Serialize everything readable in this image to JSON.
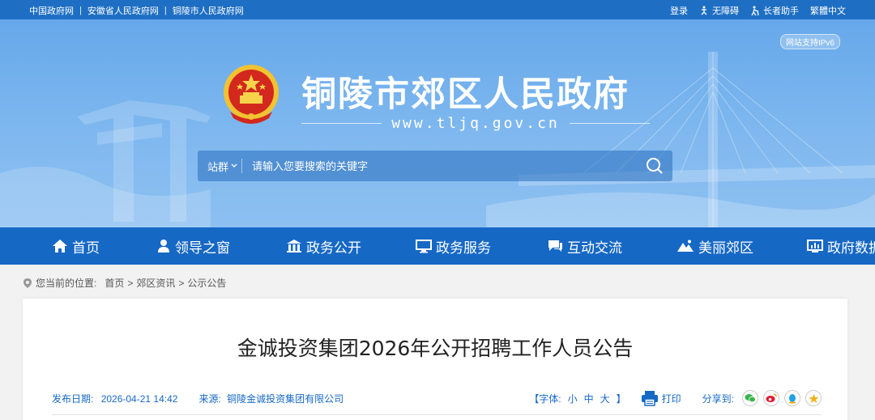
{
  "topbar": {
    "links": [
      "中国政府网",
      "安徽省人民政府网",
      "铜陵市人民政府网"
    ],
    "separator": "|",
    "login": "登录",
    "accessibility": "无障碍",
    "elder": "长者助手",
    "traditional": "繁體中文"
  },
  "banner": {
    "ipv6": "网站支持IPv6",
    "title": "铜陵市郊区人民政府",
    "url": "www.tljq.gov.cn"
  },
  "search": {
    "scope": "站群",
    "placeholder": "请输入您要搜索的关键字"
  },
  "nav": {
    "items": [
      "首页",
      "领导之窗",
      "政务公开",
      "政务服务",
      "互动交流",
      "美丽郊区",
      "政府数据"
    ]
  },
  "breadcrumb": {
    "prefix": "您当前的位置:",
    "items": [
      "首页",
      "郊区资讯",
      "公示公告"
    ],
    "sep": ">"
  },
  "article": {
    "title": "金诚投资集团2026年公开招聘工作人员公告",
    "date_label": "发布日期:",
    "date": "2026-04-21 14:42",
    "source_label": "来源:",
    "source": "铜陵金诚投资集团有限公司",
    "font_label": "【字体:",
    "font_small": "小",
    "font_medium": "中",
    "font_large": "大",
    "font_close": "】",
    "print": "打印",
    "share": "分享到:"
  },
  "colors": {
    "topbar": "#1e6fc4",
    "nav": "#1668c5",
    "banner": "#7fb8ef",
    "accent_text": "#1668c5"
  }
}
